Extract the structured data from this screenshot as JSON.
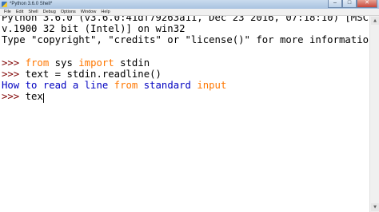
{
  "window": {
    "title": "*Python 3.6.0 Shell*",
    "controls": [
      "–",
      "□",
      "✕"
    ]
  },
  "menu": [
    "File",
    "Edit",
    "Shell",
    "Debug",
    "Options",
    "Window",
    "Help"
  ],
  "shell": {
    "banner_1": "Python 3.6.0 (v3.6.0:41df79263a11, Dec 23 2016, 07:18:10) [MSC",
    "banner_2": "v.1900 32 bit (Intel)] on win32",
    "banner_3": "Type \"copyright\", \"credits\" or \"license()\" for more informatio",
    "prompt": ">>> ",
    "cmd1_kw1": "from",
    "cmd1_mid": " sys ",
    "cmd1_kw2": "import",
    "cmd1_end": " stdin",
    "cmd2": "text = stdin.readline()",
    "out_part1": "How to read a line ",
    "out_kw": "from",
    "out_part2": " standard ",
    "out_kw2": "input",
    "current_input": "tex"
  },
  "colors": {
    "keyword": "#ff7700",
    "stdout": "#0000c0",
    "prompt": "#7f0000"
  }
}
